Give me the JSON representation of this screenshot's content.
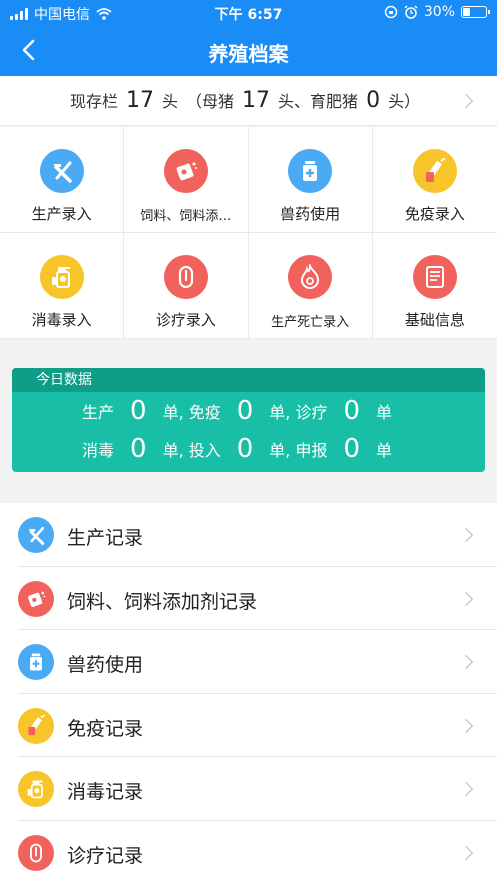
{
  "status_bar": {
    "carrier": "中国电信",
    "time": "下午 6:57",
    "battery": "30%"
  },
  "nav": {
    "title": "养殖档案"
  },
  "stock": {
    "prefix": "现存栏",
    "total": "17",
    "unit1": "头",
    "mid1": "（母猪",
    "sows": "17",
    "mid2": "头、育肥猪",
    "fatteners": "0",
    "suffix": "头）"
  },
  "grid": [
    {
      "label": "生产录入",
      "icon": "hammer-icon",
      "color": "blue"
    },
    {
      "label": "饲料、饲料添…",
      "icon": "feed-bag-icon",
      "color": "red"
    },
    {
      "label": "兽药使用",
      "icon": "medicine-bottle-icon",
      "color": "blue"
    },
    {
      "label": "免疫录入",
      "icon": "syringe-icon",
      "color": "yellow"
    },
    {
      "label": "消毒录入",
      "icon": "spray-bottle-icon",
      "color": "yellow"
    },
    {
      "label": "诊疗录入",
      "icon": "capsule-icon",
      "color": "red"
    },
    {
      "label": "生产死亡录入",
      "icon": "flame-icon",
      "color": "red"
    },
    {
      "label": "基础信息",
      "icon": "document-icon",
      "color": "red"
    }
  ],
  "today": {
    "title": "今日数据",
    "row1": {
      "l1": "生产",
      "v1": "0",
      "l2": "单, 免疫",
      "v2": "0",
      "l3": "单, 诊疗",
      "v3": "0",
      "l4": "单"
    },
    "row2": {
      "l1": "消毒",
      "v1": "0",
      "l2": "单, 投入",
      "v2": "0",
      "l3": "单, 申报",
      "v3": "0",
      "l4": "单"
    }
  },
  "records": [
    {
      "label": "生产记录",
      "icon": "hammer-icon",
      "color": "blue"
    },
    {
      "label": "饲料、饲料添加剂记录",
      "icon": "feed-bag-icon",
      "color": "red"
    },
    {
      "label": "兽药使用",
      "icon": "medicine-bottle-icon",
      "color": "blue"
    },
    {
      "label": "免疫记录",
      "icon": "syringe-icon",
      "color": "yellow"
    },
    {
      "label": "消毒记录",
      "icon": "spray-bottle-icon",
      "color": "yellow"
    },
    {
      "label": "诊疗记录",
      "icon": "capsule-icon",
      "color": "red"
    }
  ],
  "colors": {
    "header": "#1a8cf6",
    "today_bg": "#18bfa6",
    "today_head": "#0f9d88",
    "blue": "#4aaaf3",
    "red": "#f0625b",
    "yellow": "#f7c42a"
  }
}
